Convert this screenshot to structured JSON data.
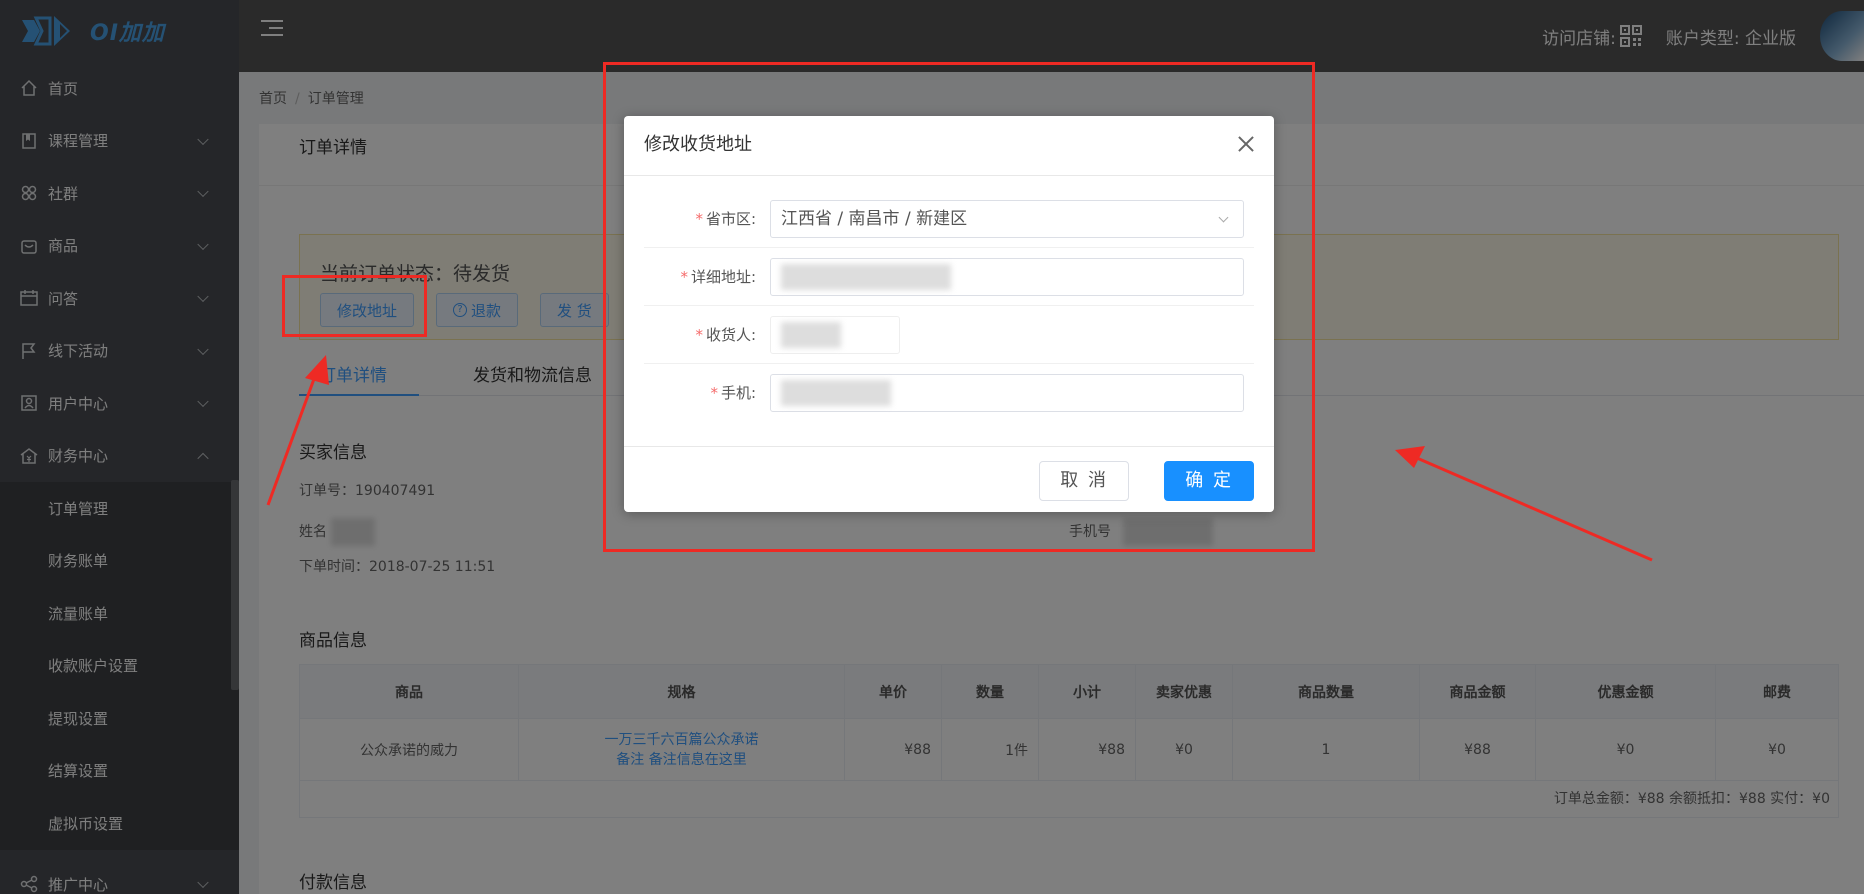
{
  "logo": {
    "text": "OI加加"
  },
  "sidebar": {
    "items": [
      {
        "label": "首页",
        "icon": "home-icon",
        "expandable": false
      },
      {
        "label": "课程管理",
        "icon": "book-icon",
        "expandable": true
      },
      {
        "label": "社群",
        "icon": "community-icon",
        "expandable": true
      },
      {
        "label": "商品",
        "icon": "goods-icon",
        "expandable": true
      },
      {
        "label": "问答",
        "icon": "qa-icon",
        "expandable": true
      },
      {
        "label": "线下活动",
        "icon": "flag-icon",
        "expandable": true
      },
      {
        "label": "用户中心",
        "icon": "user-center-icon",
        "expandable": true
      },
      {
        "label": "财务中心",
        "icon": "finance-icon",
        "expandable": true,
        "expanded": true
      }
    ],
    "finance_sub": [
      "订单管理",
      "财务账单",
      "流量账单",
      "收款账户设置",
      "提现设置",
      "结算设置",
      "虚拟币设置"
    ],
    "after": {
      "label": "推广中心",
      "icon": "share-icon"
    }
  },
  "header": {
    "visit_store": "访问店铺:",
    "account_type": "账户类型: 企业版"
  },
  "breadcrumb": {
    "home": "首页",
    "current": "订单管理"
  },
  "page": {
    "title": "订单详情",
    "status": "当前订单状态：待发货",
    "buttons": {
      "modify_address": "修改地址",
      "refund": "退款",
      "ship": "发 货"
    },
    "tabs": [
      "订单详情",
      "发货和物流信息"
    ],
    "buyer_section": "买家信息",
    "order_no": "订单号：190407491",
    "name_label": "姓名",
    "order_time": "下单时间：2018-07-25 11:51",
    "phone_label": "手机号",
    "goods_section": "商品信息",
    "pay_section": "付款信息"
  },
  "goods_table": {
    "headers": [
      "商品",
      "规格",
      "单价",
      "数量",
      "小计",
      "卖家优惠",
      "商品数量",
      "商品金额",
      "优惠金额",
      "邮费"
    ],
    "row": {
      "name": "公众承诺的威力",
      "spec_line1": "一万三千六百篇公众承诺",
      "spec_line2": "备注 备注信息在这里",
      "price": "¥88",
      "qty": "1件",
      "subtotal": "¥88",
      "seller_discount": "¥0",
      "goods_count": "1",
      "goods_amount": "¥88",
      "discount_amount": "¥0",
      "postage": "¥0"
    },
    "totals": "订单总金额：¥88   余额抵扣：¥88   实付：¥0"
  },
  "dialog": {
    "title": "修改收货地址",
    "fields": {
      "region_label": "省市区:",
      "region_value": "江西省 / 南昌市 / 新建区",
      "address_label": "详细地址:",
      "receiver_label": "收货人:",
      "phone_label": "手机:"
    },
    "cancel": "取 消",
    "ok": "确 定"
  },
  "colors": {
    "annotation": "#ee2a24",
    "primary": "#1890ff",
    "sidebar": "#4a4d52"
  }
}
